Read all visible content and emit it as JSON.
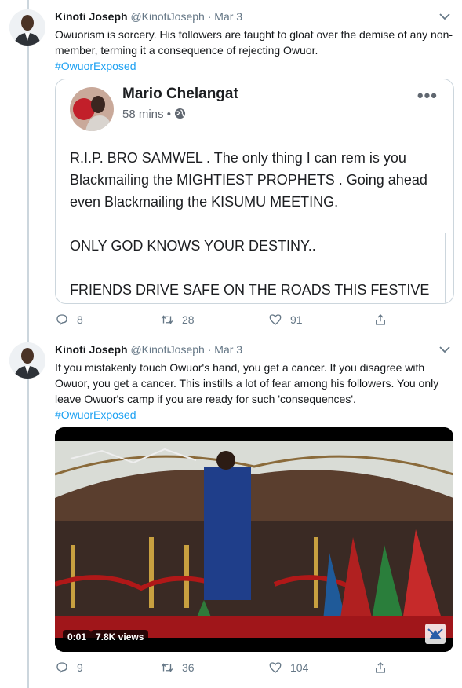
{
  "tweets": [
    {
      "author_name": "Kinoti Joseph",
      "handle": "@KinotiJoseph",
      "separator": "·",
      "date": "Mar 3",
      "text": "Owuorism is sorcery. His followers are taught to gloat over the demise of any non-member, terming it a consequence of rejecting Owuor.",
      "hashtag": "#OwuorExposed",
      "embed": {
        "author_name": "Mario Chelangat",
        "time": "58 mins",
        "time_separator": "•",
        "more": "•••",
        "paragraphs": [
          "R.I.P. BRO SAMWEL .  The only thing I can rem is you Blackmailing the MIGHTIEST PROPHETS . Going ahead even Blackmailing the KISUMU MEETING.",
          "ONLY GOD KNOWS YOUR DESTINY..",
          "FRIENDS DRIVE SAFE ON THE ROADS THIS FESTIVE SEASON.."
        ]
      },
      "replies": "8",
      "retweets": "28",
      "likes": "91"
    },
    {
      "author_name": "Kinoti Joseph",
      "handle": "@KinotiJoseph",
      "separator": "·",
      "date": "Mar 3",
      "text": "If you mistakenly touch Owuor's hand, you get a cancer. If you disagree with Owuor, you get a cancer. This instills a lot of fear among his followers. You only leave Owuor's camp if you are ready for such 'consequences'.",
      "hashtag": "#OwuorExposed",
      "video": {
        "duration": "0:01",
        "views": "7.8K views"
      },
      "replies": "9",
      "retweets": "36",
      "likes": "104"
    }
  ],
  "icons": {
    "reply": "reply-icon",
    "retweet": "retweet-icon",
    "like": "heart-icon",
    "share": "share-icon",
    "caret": "chevron-down-icon",
    "globe": "globe-icon"
  },
  "colors": {
    "link": "#1da1f2",
    "secondary_text": "#657786",
    "border": "#ccd6dd"
  }
}
